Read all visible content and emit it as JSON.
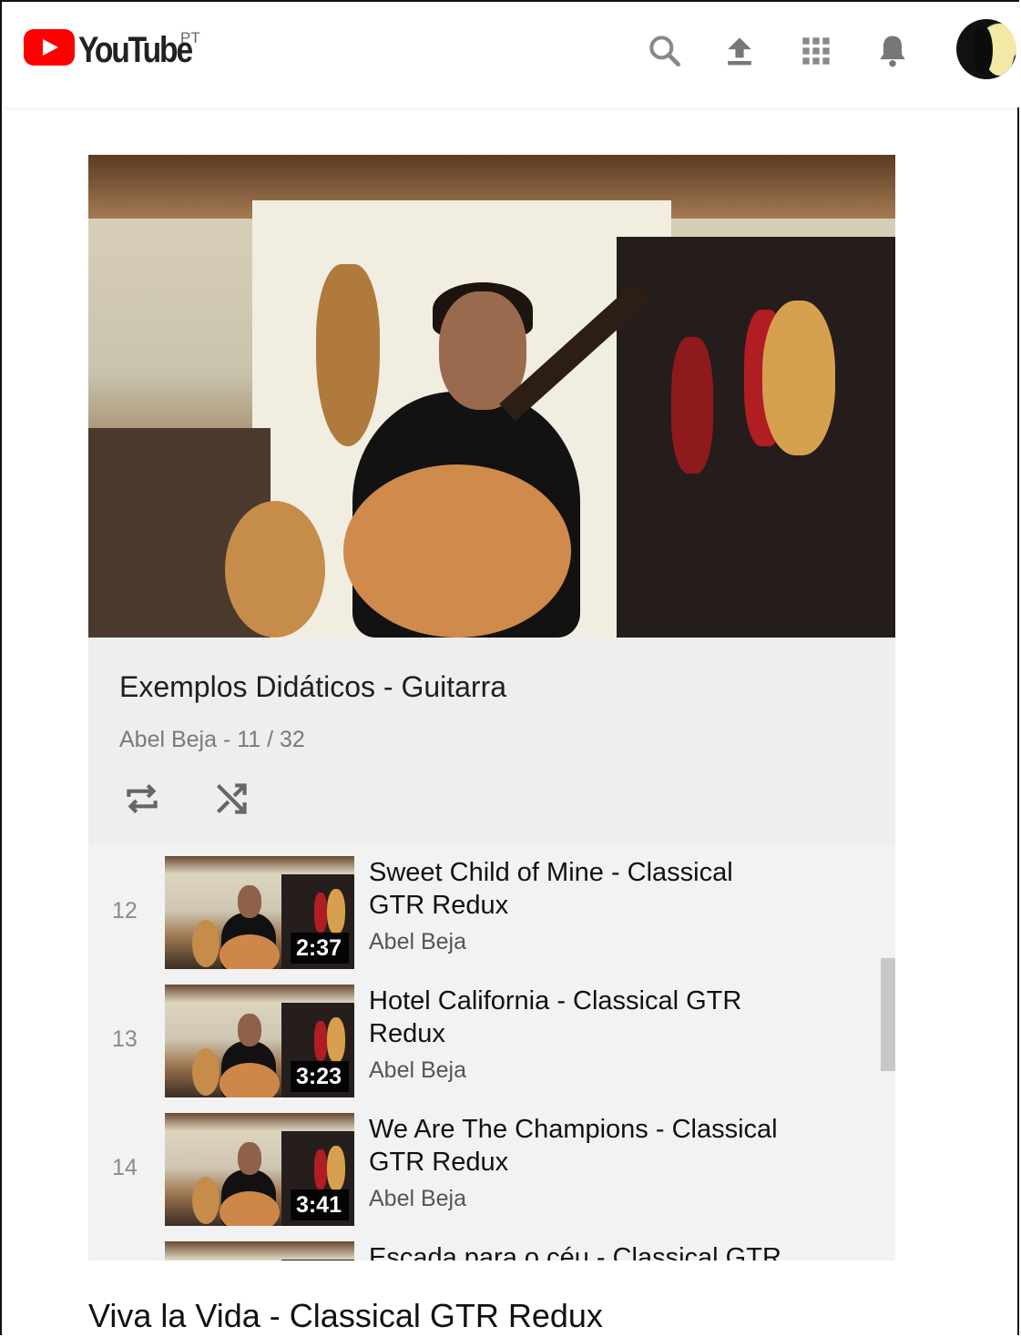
{
  "header": {
    "logo_text": "YouTube",
    "region": "PT",
    "icons": [
      "search-icon",
      "upload-icon",
      "apps-icon",
      "notifications-icon"
    ],
    "brand_color": "#ff0000"
  },
  "playlist": {
    "title": "Exemplos Didáticos - Guitarra",
    "subtitle": "Abel Beja - 11 / 32",
    "controls": [
      "loop-icon",
      "shuffle-icon"
    ],
    "items": [
      {
        "index": "12",
        "title": "Sweet Child of Mine - Classical GTR Redux",
        "channel": "Abel Beja",
        "duration": "2:37"
      },
      {
        "index": "13",
        "title": "Hotel California - Classical GTR Redux",
        "channel": "Abel Beja",
        "duration": "3:23"
      },
      {
        "index": "14",
        "title": "We Are The Champions - Classical GTR Redux",
        "channel": "Abel Beja",
        "duration": "3:41"
      },
      {
        "index": "",
        "title": "Escada para o céu - Classical GTR",
        "channel": "",
        "duration": ""
      }
    ]
  },
  "now_playing": {
    "title": "Viva la Vida - Classical GTR Redux"
  }
}
